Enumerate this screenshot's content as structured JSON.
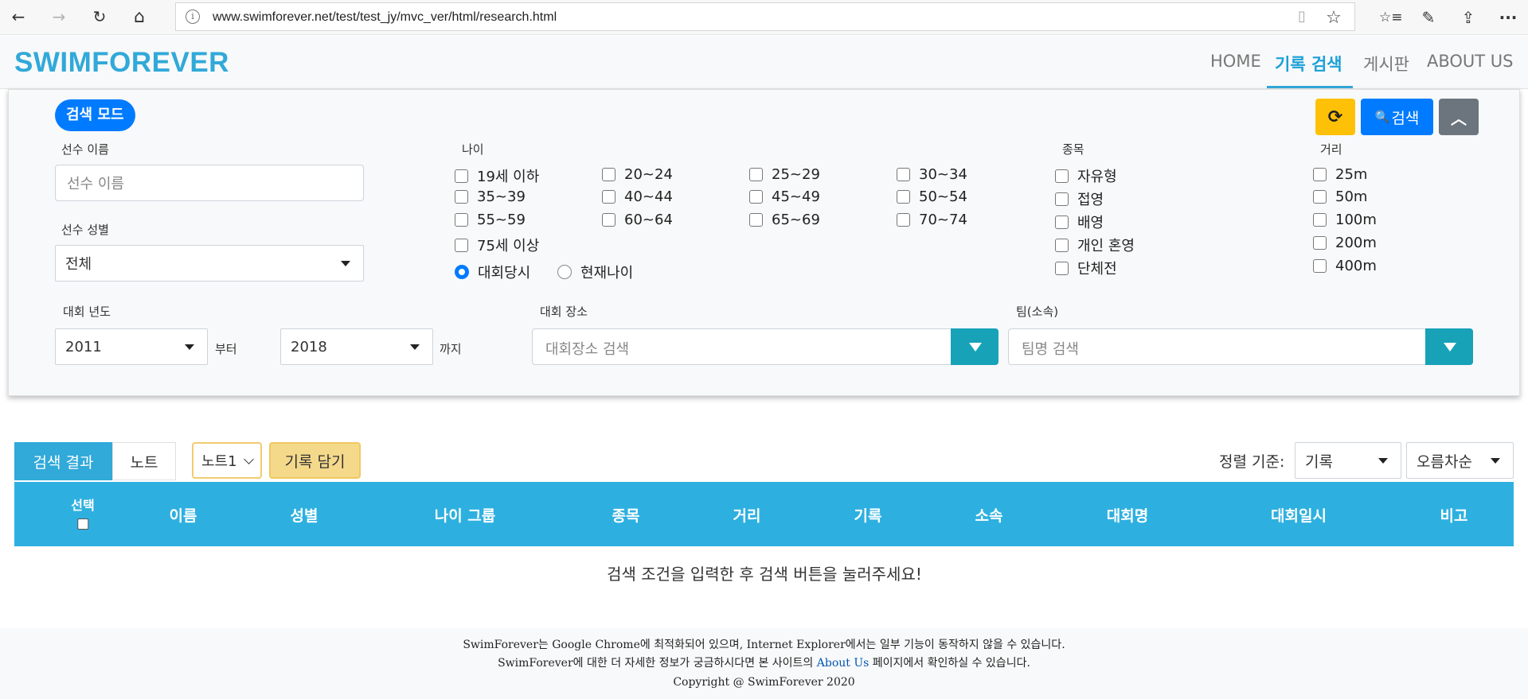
{
  "browser": {
    "url": "www.swimforever.net/test/test_jy/mvc_ver/html/research.html",
    "back_icon": "←",
    "forward_icon": "→",
    "refresh_icon": "↻",
    "home_icon": "⌂",
    "info_icon": "i",
    "reader_icon": "▯",
    "favorite_icon": "☆",
    "favorites_icon": "☆≡",
    "pen_icon": "✎",
    "share_icon": "⇪",
    "more_icon": "···"
  },
  "navbar": {
    "brand": "SWIMFOREVER",
    "items": [
      "HOME",
      "기록 검색",
      "게시판",
      "ABOUT US"
    ],
    "active": "기록 검색"
  },
  "search_panel": {
    "mode_label": "검색 모드",
    "refresh_icon": "⟳",
    "search_icon": "🔍",
    "search_label": "검색",
    "collapse_icon": "︿",
    "name_label": "선수 이름",
    "name_placeholder": "선수 이름",
    "gender_label": "선수 성별",
    "gender_value": "전체",
    "age_label": "나이",
    "age_groups": [
      "19세 이하",
      "20~24",
      "25~29",
      "30~34",
      "35~39",
      "40~44",
      "45~49",
      "50~54",
      "55~59",
      "60~64",
      "65~69",
      "70~74",
      "75세 이상"
    ],
    "age_mode_options": [
      "대회당시",
      "현재나이"
    ],
    "age_mode_selected": "대회당시",
    "stroke_label": "종목",
    "strokes": [
      "자유형",
      "접영",
      "배영",
      "개인 혼영",
      "단체전"
    ],
    "distance_label": "거리",
    "distances": [
      "25m",
      "50m",
      "100m",
      "200m",
      "400m"
    ],
    "year_label": "대회 년도",
    "year_from": "2011",
    "year_from_suffix": "부터",
    "year_to": "2018",
    "year_to_suffix": "까지",
    "venue_label": "대회 장소",
    "venue_placeholder": "대회장소 검색",
    "team_label": "팀(소속)",
    "team_placeholder": "팀명 검색"
  },
  "results": {
    "tab_results": "검색 결과",
    "tab_note": "노트",
    "note_select": "노트1",
    "save_button": "기록 담기",
    "sort_label": "정렬 기준:",
    "sort_by": "기록",
    "sort_order": "오름차순",
    "columns": [
      "선택",
      "이름",
      "성별",
      "나이 그룹",
      "종목",
      "거리",
      "기록",
      "소속",
      "대회명",
      "대회일시",
      "비고"
    ],
    "empty_message": "검색 조건을 입력한 후 검색 버튼을 눌러주세요!"
  },
  "footer": {
    "line1": "SwimForever는 Google Chrome에 최적화되어 있으며, Internet Explorer에서는 일부 기능이 동작하지 않을 수 있습니다.",
    "line2_pre": "SwimForever에 대한 더 자세한 정보가 궁금하시다면 본 사이트의",
    "line2_link": "About Us",
    "line2_post": "페이지에서 확인하실 수 있습니다.",
    "copyright": "Copyright @ SwimForever 2020"
  },
  "colors": {
    "brand": "#31a9d9",
    "primary": "#007bff",
    "warning": "#ffc107",
    "info": "#17a2b8",
    "secondary": "#6c757d",
    "table_header": "#2db0e0"
  }
}
